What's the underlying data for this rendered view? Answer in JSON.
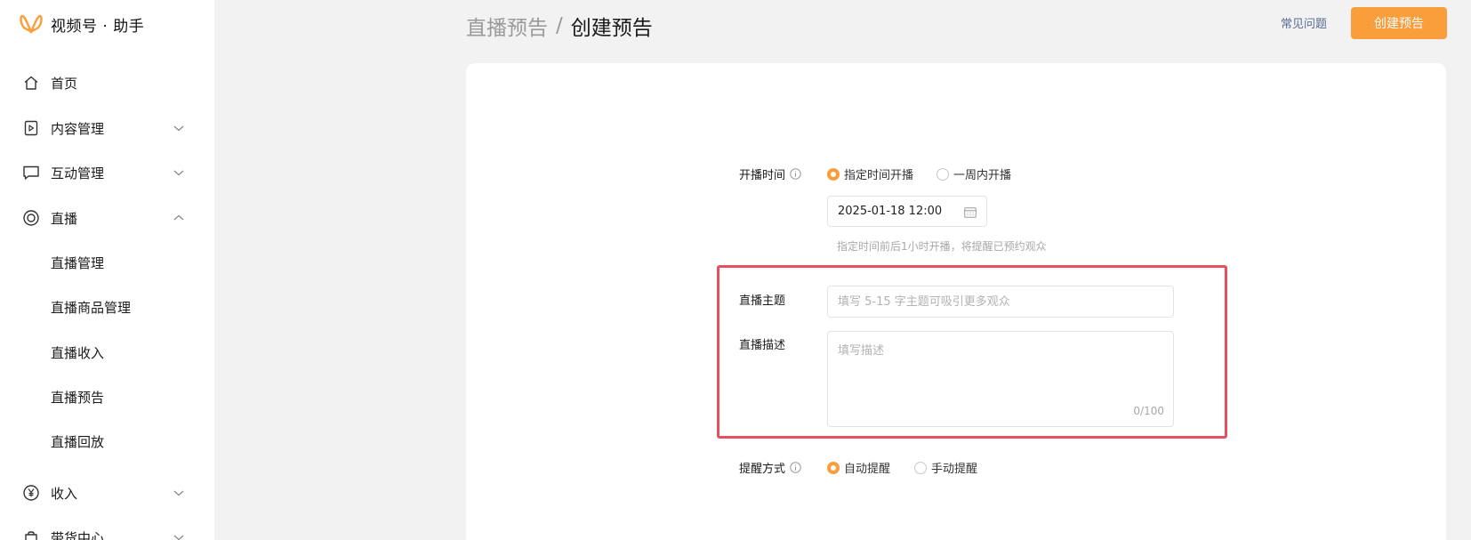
{
  "brand": {
    "name": "视频号 · 助手",
    "logo_icon": "butterfly-logo-icon",
    "logo_color": "#fa9d3b"
  },
  "sidebar": {
    "items": [
      {
        "label": "首页",
        "icon": "home-icon"
      },
      {
        "label": "内容管理",
        "icon": "play-square-icon",
        "expanded": false
      },
      {
        "label": "互动管理",
        "icon": "chat-bubble-icon",
        "expanded": false
      },
      {
        "label": "直播",
        "icon": "live-circle-icon",
        "expanded": true
      },
      {
        "label": "收入",
        "icon": "yen-circle-icon",
        "expanded": false
      },
      {
        "label": "带货中心",
        "icon": "shopping-bag-icon",
        "expanded": false
      }
    ],
    "live_sub": [
      {
        "label": "直播管理"
      },
      {
        "label": "直播商品管理"
      },
      {
        "label": "直播收入"
      },
      {
        "label": "直播预告"
      },
      {
        "label": "直播回放"
      }
    ]
  },
  "header": {
    "breadcrumb_parent": "直播预告",
    "breadcrumb_sep": "/",
    "breadcrumb_current": "创建预告",
    "faq_label": "常见问题",
    "create_button": "创建预告",
    "accent_color": "#fa9d3b"
  },
  "form": {
    "start_time": {
      "label": "开播时间",
      "option_specified": "指定时间开播",
      "option_week": "一周内开播",
      "selected": "指定时间开播",
      "date_value": "2025-01-18 12:00",
      "hint": "指定时间前后1小时开播，将提醒已预约观众"
    },
    "topic": {
      "label": "直播主题",
      "placeholder": "填写 5-15 字主题可吸引更多观众"
    },
    "description": {
      "label": "直播描述",
      "placeholder": "填写描述",
      "counter": "0/100"
    },
    "reminder": {
      "label": "提醒方式",
      "option_auto": "自动提醒",
      "option_manual": "手动提醒",
      "selected": "自动提醒"
    },
    "highlight_color": "#e6505f"
  }
}
